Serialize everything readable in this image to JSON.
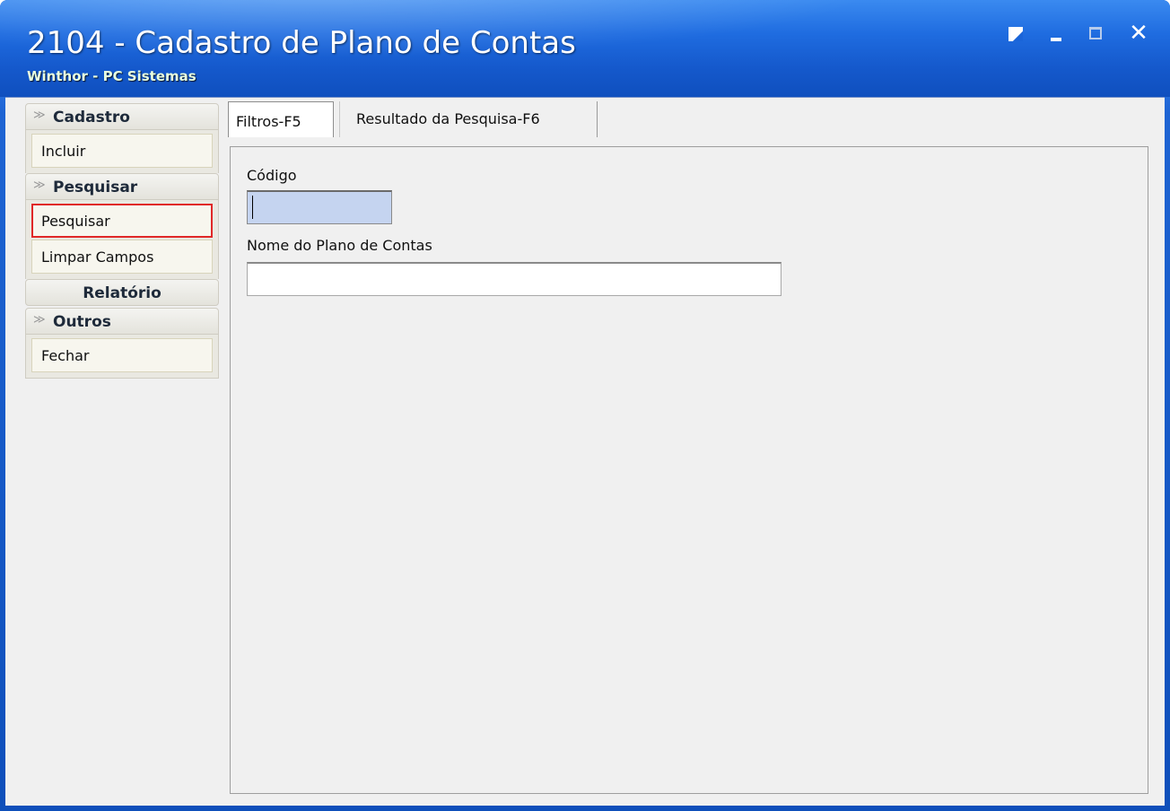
{
  "window": {
    "title": "2104 - Cadastro de Plano de Contas",
    "subtitle": "Winthor - PC Sistemas",
    "controls": {
      "help_icon": "help-icon",
      "minimize": "_",
      "close": "✕"
    }
  },
  "sidebar": {
    "groups": [
      {
        "title": "Cadastro",
        "items": [
          "Incluir"
        ]
      },
      {
        "title": "Pesquisar",
        "items": [
          "Pesquisar",
          "Limpar Campos"
        ]
      },
      {
        "title": "Relatório",
        "items": []
      },
      {
        "title": "Outros",
        "items": [
          "Fechar"
        ]
      }
    ]
  },
  "tabs": [
    {
      "label": "Filtros-F5",
      "active": true
    },
    {
      "label": "Resultado da Pesquisa-F6",
      "active": false
    }
  ],
  "filters": {
    "code_label": "Código",
    "code_value": "",
    "name_label": "Nome do Plano de Contas",
    "name_value": ""
  },
  "colors": {
    "titlebar": "#1f6ce0",
    "highlight_border": "#e02828",
    "focused_field": "#c5d4f0"
  }
}
